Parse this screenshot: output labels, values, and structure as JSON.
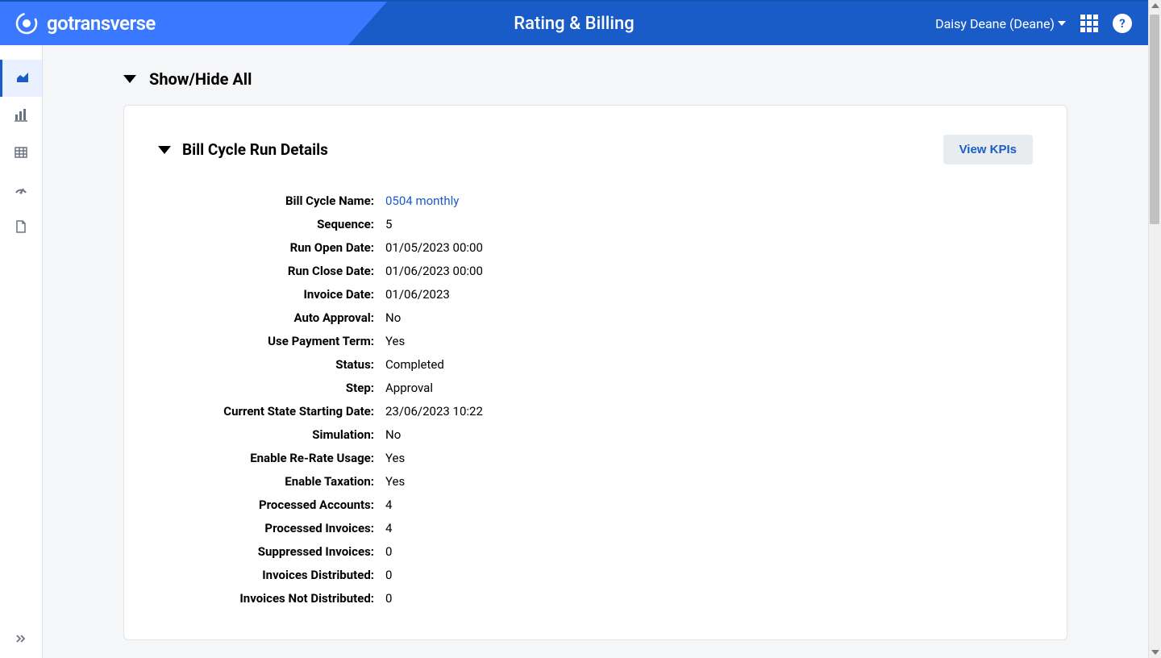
{
  "header": {
    "brand": "gotransverse",
    "title": "Rating & Billing",
    "user": "Daisy Deane (Deane)"
  },
  "toggle": {
    "label": "Show/Hide All"
  },
  "card": {
    "title": "Bill Cycle Run Details",
    "kpi_button": "View KPIs"
  },
  "details": {
    "bill_cycle_name": {
      "label": "Bill Cycle Name:",
      "value": "0504 monthly",
      "link": true
    },
    "sequence": {
      "label": "Sequence:",
      "value": "5"
    },
    "run_open_date": {
      "label": "Run Open Date:",
      "value": "01/05/2023 00:00"
    },
    "run_close_date": {
      "label": "Run Close Date:",
      "value": "01/06/2023 00:00"
    },
    "invoice_date": {
      "label": "Invoice Date:",
      "value": "01/06/2023"
    },
    "auto_approval": {
      "label": "Auto Approval:",
      "value": "No"
    },
    "use_payment_term": {
      "label": "Use Payment Term:",
      "value": "Yes"
    },
    "status": {
      "label": "Status:",
      "value": "Completed"
    },
    "step": {
      "label": "Step:",
      "value": "Approval"
    },
    "current_state_starting_date": {
      "label": "Current State Starting Date:",
      "value": "23/06/2023 10:22"
    },
    "simulation": {
      "label": "Simulation:",
      "value": "No"
    },
    "enable_re_rate_usage": {
      "label": "Enable Re-Rate Usage:",
      "value": "Yes"
    },
    "enable_taxation": {
      "label": "Enable Taxation:",
      "value": "Yes"
    },
    "processed_accounts": {
      "label": "Processed Accounts:",
      "value": "4"
    },
    "processed_invoices": {
      "label": "Processed Invoices:",
      "value": "4"
    },
    "suppressed_invoices": {
      "label": "Suppressed Invoices:",
      "value": "0"
    },
    "invoices_distributed": {
      "label": "Invoices Distributed:",
      "value": "0"
    },
    "invoices_not_distributed": {
      "label": "Invoices Not Distributed:",
      "value": "0"
    }
  }
}
